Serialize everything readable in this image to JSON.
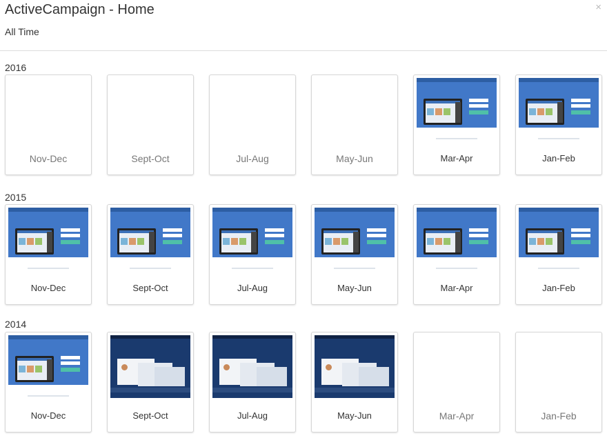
{
  "header": {
    "title": "ActiveCampaign - Home",
    "subtitle": "All Time",
    "close_label": "×"
  },
  "colors": {
    "accent": "#4178c8",
    "border": "#d6d6d6"
  },
  "years": [
    {
      "year": "2016",
      "cards": [
        {
          "label": "Nov-Dec",
          "thumbnail": false
        },
        {
          "label": "Sept-Oct",
          "thumbnail": false
        },
        {
          "label": "Jul-Aug",
          "thumbnail": false
        },
        {
          "label": "May-Jun",
          "thumbnail": false
        },
        {
          "label": "Mar-Apr",
          "thumbnail": true
        },
        {
          "label": "Jan-Feb",
          "thumbnail": true
        }
      ]
    },
    {
      "year": "2015",
      "cards": [
        {
          "label": "Nov-Dec",
          "thumbnail": true
        },
        {
          "label": "Sept-Oct",
          "thumbnail": true
        },
        {
          "label": "Jul-Aug",
          "thumbnail": true
        },
        {
          "label": "May-Jun",
          "thumbnail": true
        },
        {
          "label": "Mar-Apr",
          "thumbnail": true
        },
        {
          "label": "Jan-Feb",
          "thumbnail": true
        }
      ]
    },
    {
      "year": "2014",
      "cards": [
        {
          "label": "Nov-Dec",
          "thumbnail": true
        },
        {
          "label": "Sept-Oct",
          "thumbnail": true
        },
        {
          "label": "Jul-Aug",
          "thumbnail": true
        },
        {
          "label": "May-Jun",
          "thumbnail": true
        },
        {
          "label": "Mar-Apr",
          "thumbnail": false
        },
        {
          "label": "Jan-Feb",
          "thumbnail": false
        }
      ]
    }
  ]
}
